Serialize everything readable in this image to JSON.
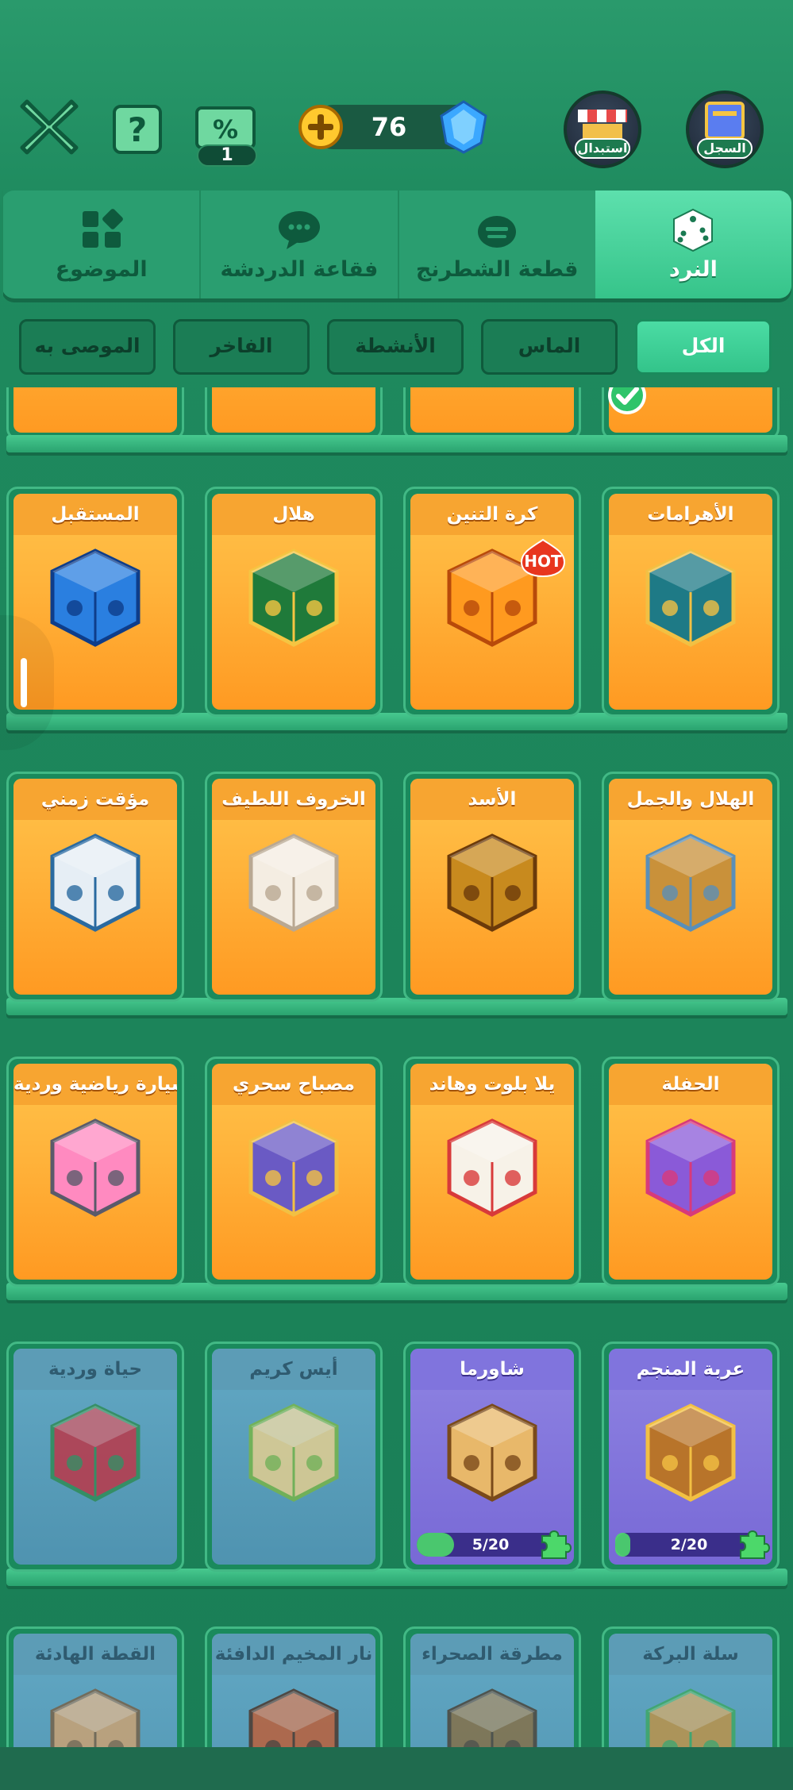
{
  "header": {
    "ticket_count": "1",
    "gem_count": "76",
    "swap_label": "استبدال",
    "log_label": "السجل"
  },
  "tabs": [
    {
      "label": "النرد",
      "icon": "dice-icon",
      "active": true
    },
    {
      "label": "قطعة الشطرنج",
      "icon": "chess-piece-icon",
      "active": false
    },
    {
      "label": "فقاعة الدردشة",
      "icon": "chat-bubble-icon",
      "active": false
    },
    {
      "label": "الموضوع",
      "icon": "theme-grid-icon",
      "active": false
    }
  ],
  "filters": [
    {
      "label": "الكل",
      "active": true
    },
    {
      "label": "الماس",
      "active": false
    },
    {
      "label": "الأنشطة",
      "active": false
    },
    {
      "label": "الفاخر",
      "active": false
    },
    {
      "label": "الموصى به",
      "active": false
    }
  ],
  "rows": [
    [
      {
        "title": "الأهرامات",
        "style": "orange",
        "art": "pharaoh-dice"
      },
      {
        "title": "كرة التنين",
        "style": "orange",
        "art": "dragon-dice",
        "badge": "HOT"
      },
      {
        "title": "هلال",
        "style": "orange",
        "art": "crescent-dice"
      },
      {
        "title": "المستقبل",
        "style": "orange",
        "art": "future-dice"
      }
    ],
    [
      {
        "title": "الهلال والجمل",
        "style": "orange",
        "art": "camel-dice"
      },
      {
        "title": "الأسد",
        "style": "orange",
        "art": "lion-dice"
      },
      {
        "title": "الخروف اللطيف",
        "style": "orange",
        "art": "sheep-dice"
      },
      {
        "title": "مؤقت زمني",
        "style": "orange",
        "art": "timer-dice"
      }
    ],
    [
      {
        "title": "الحفلة",
        "style": "orange",
        "art": "party-dice"
      },
      {
        "title": "يلا بلوت وهاند",
        "style": "orange",
        "art": "cards-dice"
      },
      {
        "title": "مصباح سحري",
        "style": "orange",
        "art": "lamp-dice"
      },
      {
        "title": "سيارة رياضية وردية",
        "style": "orange",
        "art": "pink-car-dice"
      }
    ],
    [
      {
        "title": "عربة المنجم",
        "style": "purple",
        "art": "mine-cart-dice",
        "progress": "2/20",
        "fill": 0.1
      },
      {
        "title": "شاورما",
        "style": "purple",
        "art": "shawarma-dice",
        "progress": "5/20",
        "fill": 0.25
      },
      {
        "title": "أيس كريم",
        "style": "locked",
        "art": "ice-cream-dice"
      },
      {
        "title": "حياة وردية",
        "style": "locked",
        "art": "rose-dice"
      }
    ],
    [
      {
        "title": "سلة البركة",
        "style": "locked",
        "art": "basket-dice"
      },
      {
        "title": "مطرقة الصحراء",
        "style": "locked",
        "art": "desert-hammer-dice"
      },
      {
        "title": "نار المخيم الدافئة",
        "style": "locked",
        "art": "campfire-dice"
      },
      {
        "title": "القطة الهادئة",
        "style": "locked",
        "art": "calm-cat-dice"
      }
    ]
  ],
  "colors": {
    "background": "#1e8a5e",
    "active_tab": "#36c48a",
    "card_orange": "#ffb23a",
    "card_purple": "#7869d6",
    "card_locked": "#4f93b0"
  }
}
